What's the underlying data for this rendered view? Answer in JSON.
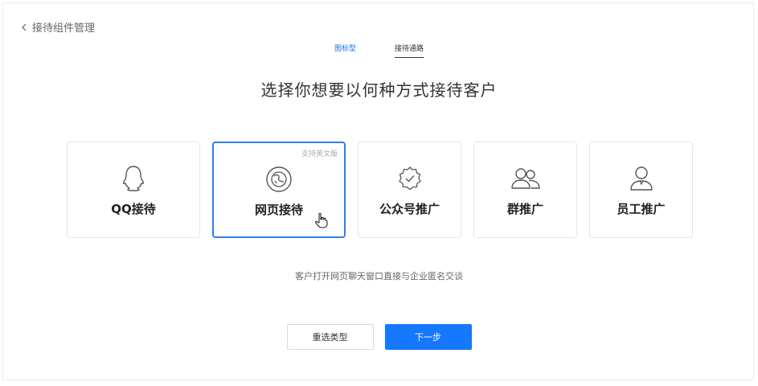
{
  "header": {
    "back_label": "接待组件管理"
  },
  "tabs": [
    {
      "label": "图标型",
      "active": false
    },
    {
      "label": "接待通路",
      "active": true
    }
  ],
  "headline": "选择你想要以何种方式接待客户",
  "cards": [
    {
      "label": "QQ接待",
      "icon": "qq-icon",
      "selected": false
    },
    {
      "label": "网页接待",
      "icon": "web-chat-icon",
      "selected": true,
      "tag": "支持英文版"
    },
    {
      "label": "公众号推广",
      "icon": "verified-badge-icon",
      "selected": false
    },
    {
      "label": "群推广",
      "icon": "group-icon",
      "selected": false
    },
    {
      "label": "员工推广",
      "icon": "employee-icon",
      "selected": false
    }
  ],
  "description": "客户打开网页聊天窗口直接与企业匿名交谈",
  "actions": {
    "reselect_label": "重选类型",
    "next_label": "下一步"
  },
  "colors": {
    "primary": "#1677ff",
    "selected_border": "#2f7fe6",
    "tab_blue": "#1a73e8"
  }
}
